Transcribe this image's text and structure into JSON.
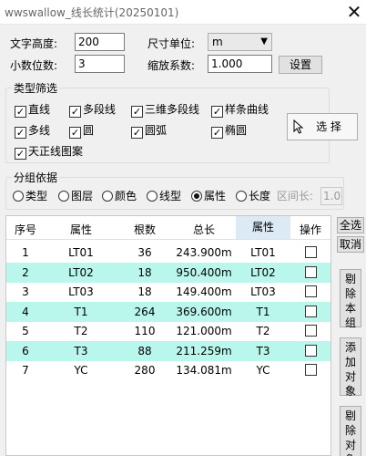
{
  "window": {
    "title": "wwswallow_线长统计(20250101)",
    "close_glyph": "✕"
  },
  "settings": {
    "text_height_label": "文字高度:",
    "text_height_value": "200",
    "decimal_label": "小数位数:",
    "decimal_value": "3",
    "unit_label": "尺寸单位:",
    "unit_value": "m",
    "scale_label": "缩放系数:",
    "scale_value": "1.000",
    "setup_button": "设置"
  },
  "type_filter": {
    "title": "类型筛选",
    "items": [
      {
        "label": "直线",
        "checked": true
      },
      {
        "label": "多段线",
        "checked": true
      },
      {
        "label": "三维多段线",
        "checked": true
      },
      {
        "label": "样条曲线",
        "checked": true
      },
      {
        "label": "多线",
        "checked": true
      },
      {
        "label": "圆",
        "checked": true
      },
      {
        "label": "圆弧",
        "checked": true
      },
      {
        "label": "椭圆",
        "checked": true
      },
      {
        "label": "天正线图案",
        "checked": true
      }
    ],
    "select_button": "选 择",
    "check_glyph": "✓"
  },
  "grouping": {
    "title": "分组依据",
    "options": [
      "类型",
      "图层",
      "颜色",
      "线型",
      "属性",
      "长度"
    ],
    "selected": "属性",
    "interval_label": "区间长:",
    "interval_value": "1.0"
  },
  "table": {
    "headers": [
      "序号",
      "属性",
      "根数",
      "总长",
      "属性",
      "操作"
    ],
    "rows": [
      [
        "1",
        "LT01",
        "36",
        "243.900m",
        "LT01"
      ],
      [
        "2",
        "LT02",
        "18",
        "950.400m",
        "LT02"
      ],
      [
        "3",
        "LT03",
        "18",
        "149.400m",
        "LT03"
      ],
      [
        "4",
        "T1",
        "264",
        "369.600m",
        "T1"
      ],
      [
        "5",
        "T2",
        "110",
        "121.000m",
        "T2"
      ],
      [
        "6",
        "T3",
        "88",
        "211.259m",
        "T3"
      ],
      [
        "7",
        "YC",
        "280",
        "134.081m",
        "YC"
      ]
    ],
    "highlight_color": "#b9f7ec",
    "header_highlight_color": "#dceaf6"
  },
  "side_buttons": {
    "select_all": "全选",
    "cancel": "取消",
    "remove_group": "剔除本组",
    "add_object": "添加对象",
    "remove_object": "剔除对象"
  }
}
